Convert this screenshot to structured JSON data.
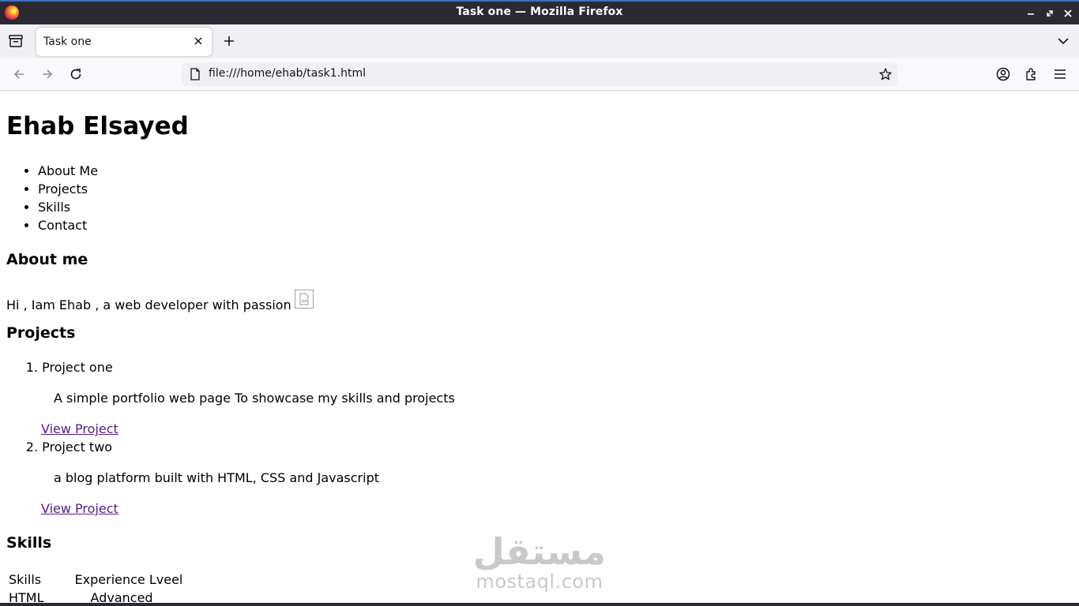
{
  "window": {
    "title": "Task one — Mozilla Firefox"
  },
  "tabs": [
    {
      "label": "Task one",
      "active": true
    }
  ],
  "navbar": {
    "url": "file:///home/ehab/task1.html"
  },
  "page": {
    "heading": "Ehab Elsayed",
    "nav_items": [
      "About Me",
      "Projects",
      "Skills",
      "Contact"
    ],
    "about": {
      "heading": "About me",
      "text": "Hi , Iam Ehab , a web developer with passion"
    },
    "projects": {
      "heading": "Projects",
      "items": [
        {
          "number": "1.",
          "name": "Project one",
          "description": "A simple portfolio web page To showcase my skills and projects",
          "link": "View Project"
        },
        {
          "number": "2.",
          "name": "Project two",
          "description": "a blog platform built with HTML, CSS and Javascript",
          "link": "View Project"
        }
      ]
    },
    "skills": {
      "heading": "Skills",
      "columns": [
        "Skills",
        "Experience Lveel"
      ],
      "rows": [
        [
          "HTML",
          "Advanced"
        ]
      ]
    }
  },
  "watermark": {
    "arabic": "مستقل",
    "latin": "mostaql.com"
  },
  "colors": {
    "titlebar": "#2b2a33",
    "link_visited": "#551a8b",
    "urlbar_bg": "#f0f0f4"
  }
}
